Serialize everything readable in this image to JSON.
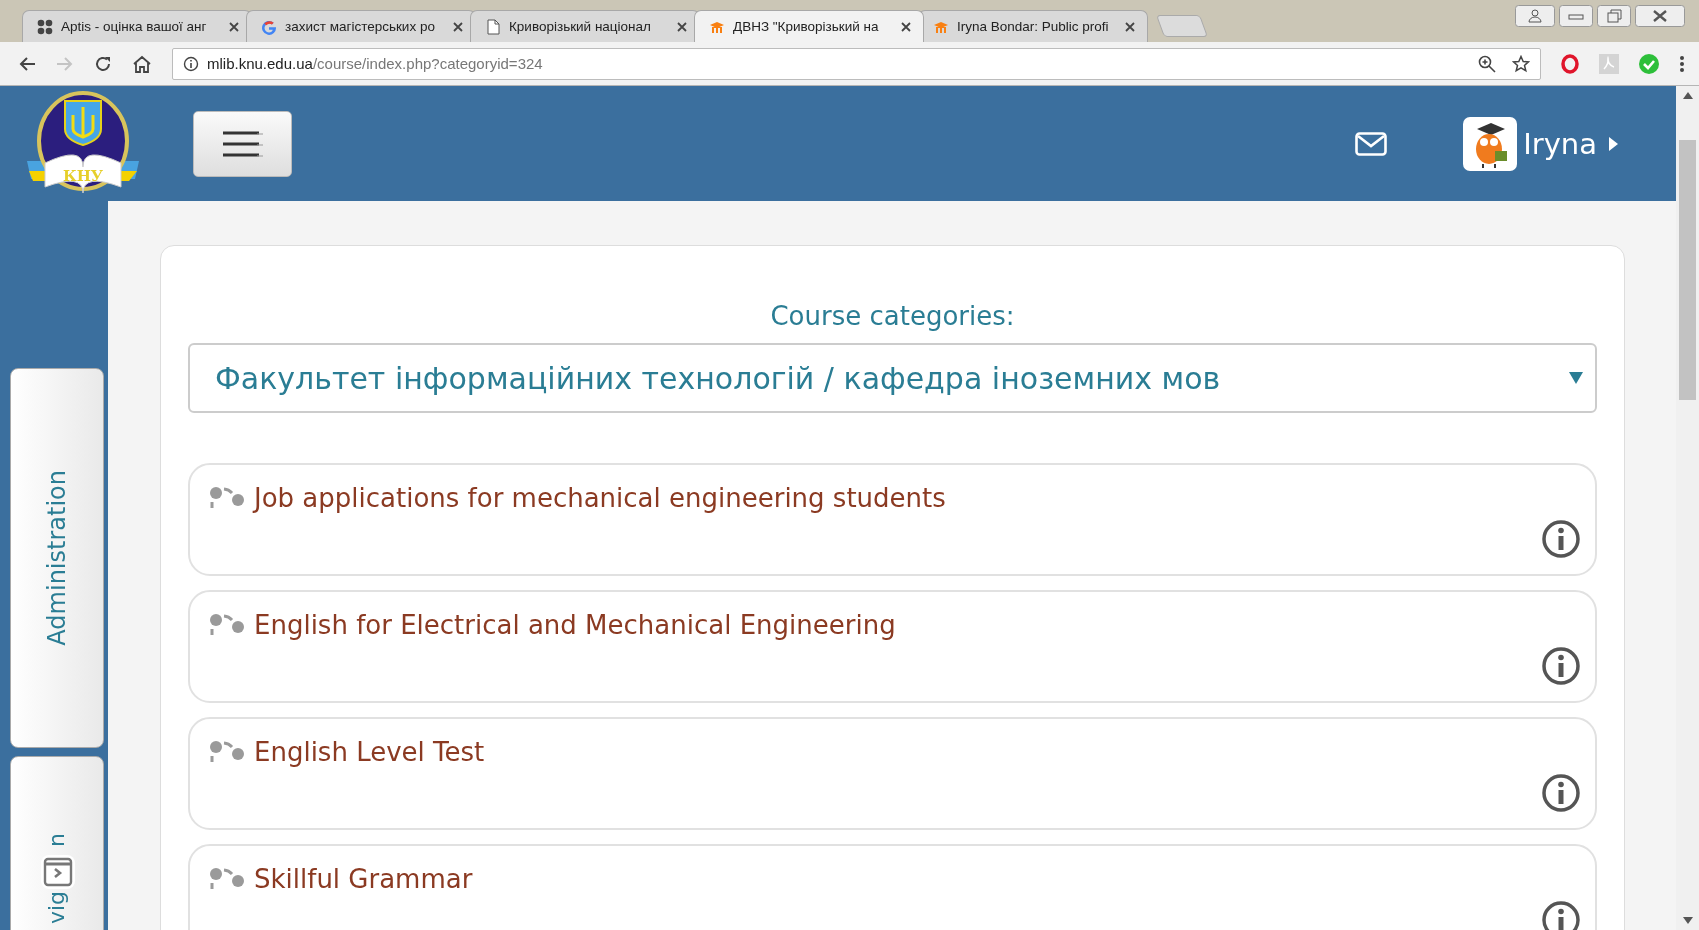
{
  "browser": {
    "tabs": [
      {
        "title": "Aptis - оцінка вашої анг",
        "kind": "grid",
        "selected": false
      },
      {
        "title": "захист магістерських ро",
        "kind": "google",
        "selected": false
      },
      {
        "title": "Криворізький націонал",
        "kind": "page",
        "selected": false
      },
      {
        "title": "ДВНЗ \"Криворізький на",
        "kind": "moodle",
        "selected": true
      },
      {
        "title": "Iryna Bondar: Public profi",
        "kind": "moodle",
        "selected": false
      }
    ],
    "address": {
      "host": "mlib.knu.edu.ua",
      "path": "/course/index.php?categoryid=324"
    },
    "forward_disabled": true
  },
  "header": {
    "logo_text": "КНУ",
    "user_name": "Iryna"
  },
  "side_tabs": [
    {
      "kind": "full",
      "label": "Administration"
    },
    {
      "kind": "partial",
      "label_start": "vig",
      "label_end": "n"
    }
  ],
  "content": {
    "heading": "Course categories:",
    "category_select": "Факультет інформаційних технологій / кафедра іноземних мов",
    "courses": [
      {
        "name": "Job applications for mechanical engineering students"
      },
      {
        "name": "English for Electrical and Mechanical Engineering"
      },
      {
        "name": "English Level Test"
      },
      {
        "name": "Skillful Grammar"
      }
    ]
  }
}
